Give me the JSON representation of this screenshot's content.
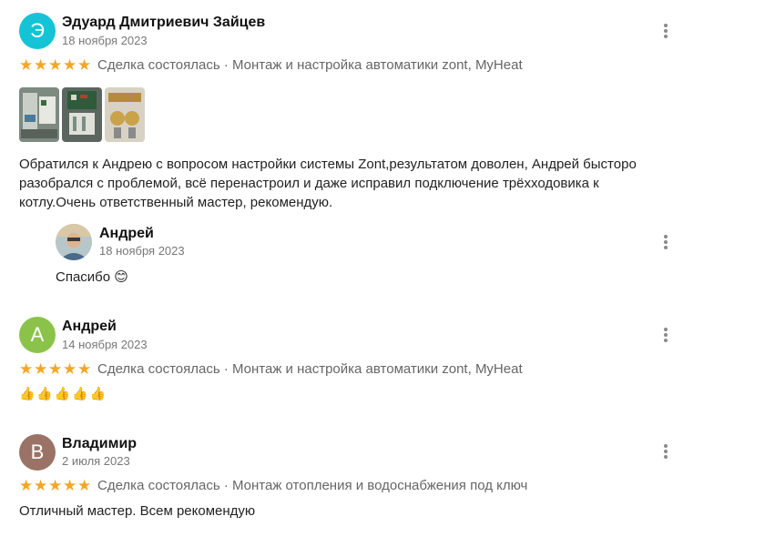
{
  "reviews": [
    {
      "avatar_letter": "Э",
      "avatar_color": "#14c4d6",
      "name": "Эдуард Дмитриевич Зайцев",
      "date": "18 ноября 2023",
      "rating": 5,
      "meta": "Сделка состоялась · Монтаж и настройка автоматики zont, MyHeat",
      "text": "Обратился к Андрею с вопросом настройки системы Zont,результатом доволен, Андрей быстоpо разобрался с проблемой, всё перенастроил и даже исправил подключение трёхходовика к котлу.Очень ответственный мастер, рекомендую.",
      "reply": {
        "name": "Андрей",
        "date": "18 ноября 2023",
        "text": "Спасибо",
        "emoji": "😊"
      }
    },
    {
      "avatar_letter": "А",
      "avatar_color": "#8bc34a",
      "name": "Андрей",
      "date": "14 ноября 2023",
      "rating": 5,
      "meta": "Сделка состоялась · Монтаж и настройка автоматики zont, MyHeat",
      "text": "👍👍👍👍👍"
    },
    {
      "avatar_letter": "В",
      "avatar_color": "#9b7366",
      "name": "Владимир",
      "date": "2 июля 2023",
      "rating": 5,
      "meta": "Сделка состоялась · Монтаж отопления и водоснабжения под ключ",
      "text": "Отличный мастер. Всем рекомендую"
    }
  ],
  "colors": {
    "star": "#f5a623",
    "date": "#777777",
    "meta": "#666666"
  }
}
